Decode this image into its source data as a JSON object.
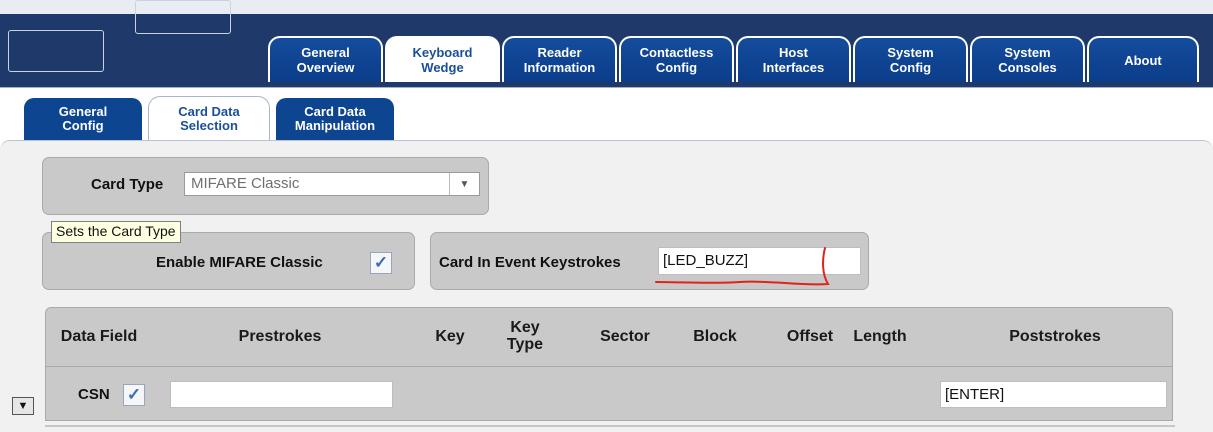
{
  "main_tabs": [
    {
      "label": "General\nOverview",
      "active": false
    },
    {
      "label": "Keyboard\nWedge",
      "active": true
    },
    {
      "label": "Reader\nInformation",
      "active": false
    },
    {
      "label": "Contactless\nConfig",
      "active": false
    },
    {
      "label": "Host\nInterfaces",
      "active": false
    },
    {
      "label": "System\nConfig",
      "active": false
    },
    {
      "label": "System\nConsoles",
      "active": false
    },
    {
      "label": "About",
      "active": false
    }
  ],
  "sub_tabs": [
    {
      "label": "General\nConfig",
      "active": false
    },
    {
      "label": "Card Data\nSelection",
      "active": true
    },
    {
      "label": "Card Data\nManipulation",
      "active": false
    }
  ],
  "card_type": {
    "label": "Card Type",
    "value": "MIFARE Classic",
    "tooltip": "Sets the Card Type"
  },
  "enable": {
    "label": "Enable MIFARE Classic",
    "checked": true
  },
  "card_in_event": {
    "label": "Card In Event Keystrokes",
    "value": "[LED_BUZZ]",
    "annotation_color": "#e2231a"
  },
  "table": {
    "headers": [
      "Data Field",
      "Prestrokes",
      "Key",
      "Key\nType",
      "Sector",
      "Block",
      "Offset",
      "Length",
      "Poststrokes"
    ],
    "rows": [
      {
        "field": "CSN",
        "checked": true,
        "prestrokes": "",
        "poststrokes": "[ENTER]"
      }
    ]
  },
  "colors": {
    "banner": "#1f3a6a",
    "tab_blue": "#0b3d8a",
    "panel_gray": "#c9c9c9"
  }
}
